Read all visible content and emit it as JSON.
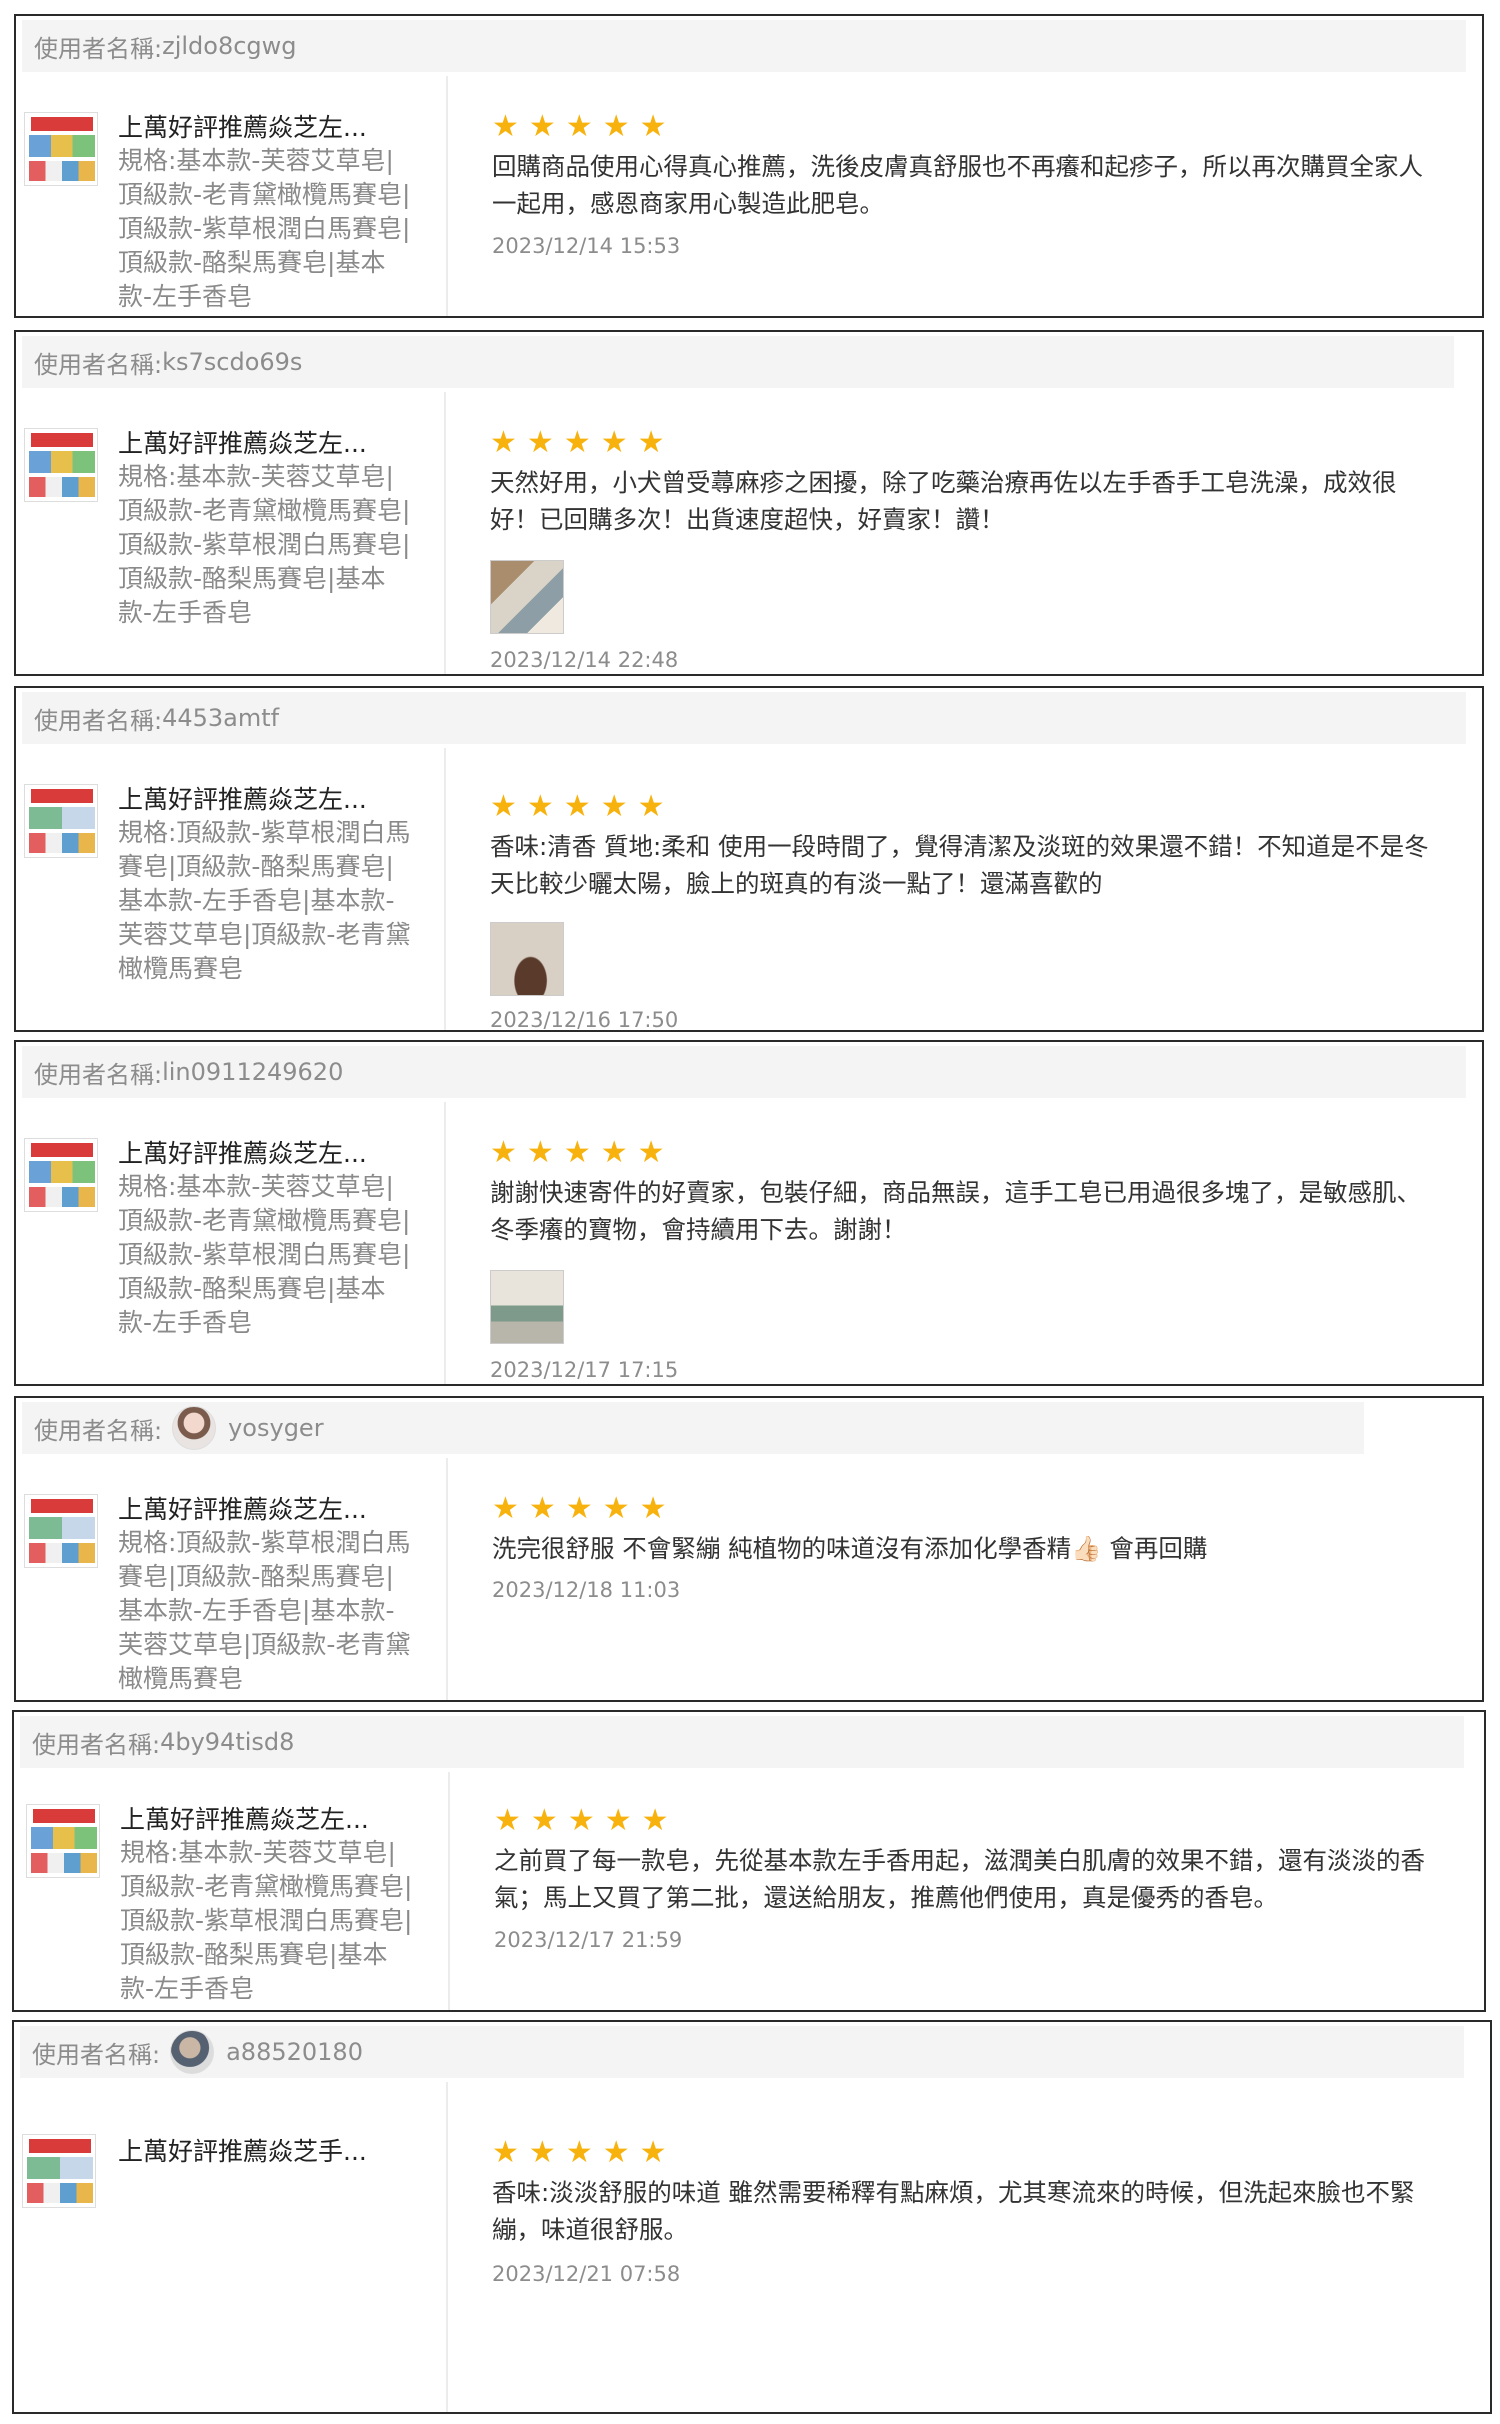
{
  "user_prefix": "使用者名稱:",
  "star_glyph": "★",
  "star_color": "#f7b20d",
  "reviews": [
    {
      "username": "zjldo8cgwg",
      "avatar": null,
      "product_name": "上萬好評推薦焱芝左...",
      "product_spec": "規格:基本款-芙蓉艾草皂|頂級款-老青黛橄欖馬賽皂|頂級款-紫草根潤白馬賽皂|頂級款-酪梨馬賽皂|基本款-左手香皂",
      "rating": 5,
      "text": "回購商品使用心得真心推薦，洗後皮膚真舒服也不再癢和起疹子，所以再次購買全家人一起用，感恩商家用心製造此肥皂。",
      "has_photo": false,
      "date": "2023/12/14 15:53"
    },
    {
      "username": "ks7scdo69s",
      "avatar": null,
      "product_name": "上萬好評推薦焱芝左...",
      "product_spec": "規格:基本款-芙蓉艾草皂|頂級款-老青黛橄欖馬賽皂|頂級款-紫草根潤白馬賽皂|頂級款-酪梨馬賽皂|基本款-左手香皂",
      "rating": 5,
      "text": "天然好用，小犬曾受蕁麻疹之困擾，除了吃藥治療再佐以左手香手工皂洗澡，成效很好！已回購多次！出貨速度超快，好賣家！讚！",
      "has_photo": true,
      "date": "2023/12/14 22:48"
    },
    {
      "username": "4453amtf",
      "avatar": null,
      "product_name": "上萬好評推薦焱芝左...",
      "product_spec": "規格:頂級款-紫草根潤白馬賽皂|頂級款-酪梨馬賽皂|基本款-左手香皂|基本款-芙蓉艾草皂|頂級款-老青黛橄欖馬賽皂",
      "rating": 5,
      "text": "香味:清香 質地:柔和 使用一段時間了，覺得清潔及淡斑的效果還不錯！不知道是不是冬天比較少曬太陽，臉上的斑真的有淡一點了！還滿喜歡的",
      "has_photo": true,
      "date": "2023/12/16 17:50"
    },
    {
      "username": "lin0911249620",
      "avatar": null,
      "product_name": "上萬好評推薦焱芝左...",
      "product_spec": "規格:基本款-芙蓉艾草皂|頂級款-老青黛橄欖馬賽皂|頂級款-紫草根潤白馬賽皂|頂級款-酪梨馬賽皂|基本款-左手香皂",
      "rating": 5,
      "text": "謝謝快速寄件的好賣家，包裝仔細，商品無誤，這手工皂已用過很多塊了，是敏感肌、冬季癢的寶物，會持續用下去。謝謝！",
      "has_photo": true,
      "date": "2023/12/17 17:15"
    },
    {
      "username": "yosyger",
      "avatar": "user-avatar",
      "product_name": "上萬好評推薦焱芝左...",
      "product_spec": "規格:頂級款-紫草根潤白馬賽皂|頂級款-酪梨馬賽皂|基本款-左手香皂|基本款-芙蓉艾草皂|頂級款-老青黛橄欖馬賽皂",
      "rating": 5,
      "text": "洗完很舒服 不會緊繃 純植物的味道沒有添加化學香精👍🏻 會再回購",
      "has_photo": false,
      "date": "2023/12/18 11:03"
    },
    {
      "username": "4by94tisd8",
      "avatar": null,
      "product_name": "上萬好評推薦焱芝左...",
      "product_spec": "規格:基本款-芙蓉艾草皂|頂級款-老青黛橄欖馬賽皂|頂級款-紫草根潤白馬賽皂|頂級款-酪梨馬賽皂|基本款-左手香皂",
      "rating": 5,
      "text": "之前買了每一款皂，先從基本款左手香用起，滋潤美白肌膚的效果不錯，還有淡淡的香氣；馬上又買了第二批，還送給朋友，推薦他們使用，真是優秀的香皂。",
      "has_photo": false,
      "date": "2023/12/17 21:59"
    },
    {
      "username": "a88520180",
      "avatar": "user-avatar",
      "product_name": "上萬好評推薦焱芝手...",
      "product_spec": "",
      "rating": 5,
      "text": "香味:淡淡舒服的味道 雖然需要稀釋有點麻煩，尤其寒流來的時候，但洗起來臉也不緊繃，味道很舒服。",
      "has_photo": false,
      "date": "2023/12/21 07:58"
    }
  ]
}
